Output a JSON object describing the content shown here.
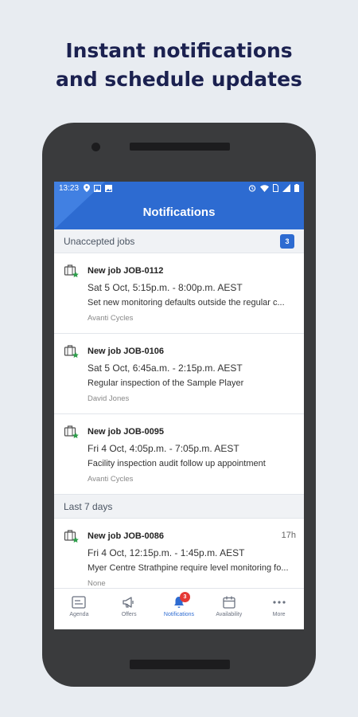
{
  "headline": {
    "line1": "Instant notifications",
    "line2": "and schedule updates"
  },
  "status_bar": {
    "time": "13:23"
  },
  "app_bar": {
    "title": "Notifications"
  },
  "sections": {
    "unaccepted": {
      "title": "Unaccepted jobs",
      "count": "3"
    },
    "last7": {
      "title": "Last 7 days"
    }
  },
  "jobs": [
    {
      "title": "New job JOB-0112",
      "schedule": "Sat 5 Oct, 5:15p.m. - 8:00p.m. AEST",
      "description": "Set new monitoring defaults outside the regular c...",
      "customer": "Avanti Cycles"
    },
    {
      "title": "New job JOB-0106",
      "schedule": "Sat 5 Oct, 6:45a.m. - 2:15p.m. AEST",
      "description": "Regular inspection of the Sample Player",
      "customer": "David Jones"
    },
    {
      "title": "New job JOB-0095",
      "schedule": "Fri 4 Oct, 4:05p.m. - 7:05p.m. AEST",
      "description": "Facility inspection audit follow up appointment",
      "customer": "Avanti Cycles"
    },
    {
      "title": "New job JOB-0086",
      "time_ago": "17h",
      "schedule": "Fri 4 Oct, 12:15p.m. - 1:45p.m. AEST",
      "description": "Myer Centre Strathpine require level monitoring fo...",
      "customer": "None"
    }
  ],
  "bottom_nav": [
    {
      "label": "Agenda",
      "icon": "agenda-icon"
    },
    {
      "label": "Offers",
      "icon": "megaphone-icon"
    },
    {
      "label": "Notifications",
      "icon": "bell-icon",
      "badge": "3",
      "active": true
    },
    {
      "label": "Availability",
      "icon": "calendar-icon"
    },
    {
      "label": "More",
      "icon": "more-dots-icon"
    }
  ],
  "colors": {
    "brand_blue": "#2d6bd1",
    "headline_navy": "#1b2150",
    "badge_red": "#e53935",
    "status_green": "#2e9e4b"
  }
}
